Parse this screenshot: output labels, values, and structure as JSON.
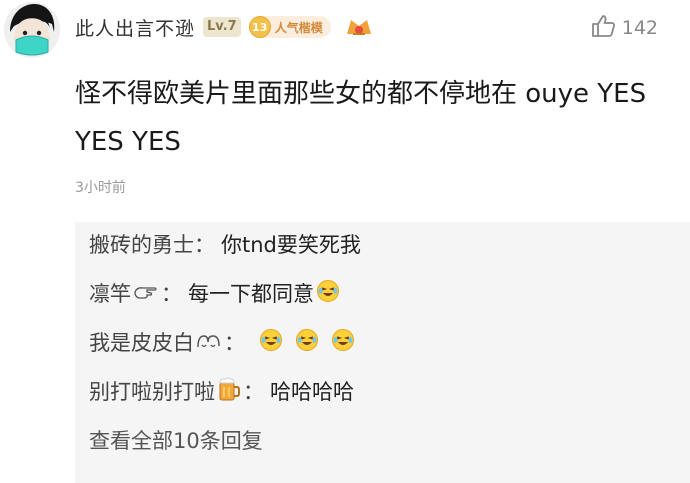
{
  "comment": {
    "username": "此人出言不逊",
    "level": "Lv.7",
    "popularity_number": "13",
    "popularity_label": "人气楷模",
    "like_count": "142",
    "text": "怪不得欧美片里面那些女的都不停地在 ouye YES YES YES",
    "time": "3小时前"
  },
  "replies": [
    {
      "user": "搬砖的勇士",
      "colon": "：",
      "text": "你tnd要笑死我",
      "user_icon": null,
      "emojis": []
    },
    {
      "user": "凛竿",
      "colon": "：",
      "text": "每一下都同意",
      "user_icon": "pointing-hand-icon",
      "emojis": [
        "laugh-cry-emoji"
      ]
    },
    {
      "user": "我是皮皮白",
      "colon": "：",
      "text": "",
      "user_icon": "cat-face-icon",
      "emojis": [
        "laugh-cry-emoji",
        "laugh-cry-emoji",
        "laugh-cry-emoji"
      ]
    },
    {
      "user": "别打啦别打啦",
      "colon": "：",
      "text": "哈哈哈哈",
      "user_icon": "beer-mug-icon",
      "emojis": []
    }
  ],
  "more_replies": "查看全部10条回复",
  "colors": {
    "background": "#ffffff",
    "reply_panel": "#f5f5f5",
    "muted": "#9a9a9a",
    "level_badge": "#ece5cf",
    "popularity_badge": "#fbeede"
  }
}
